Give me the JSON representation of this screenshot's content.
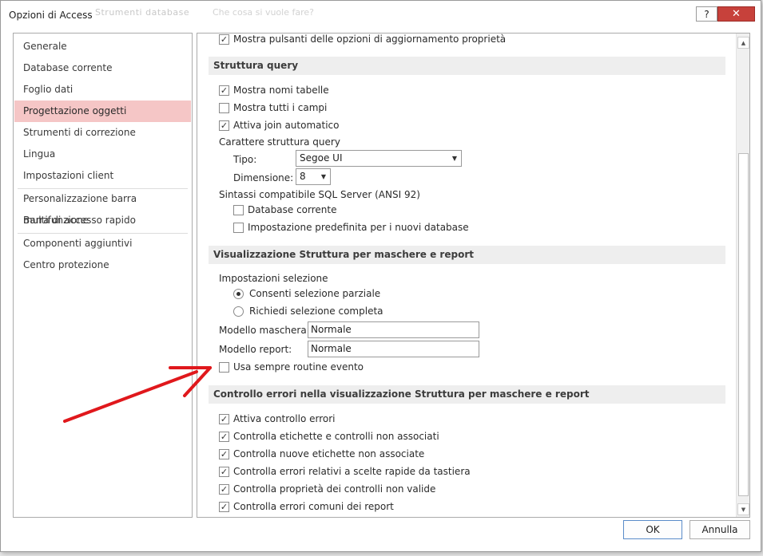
{
  "window": {
    "title": "Opzioni di Access",
    "bg_text_1": "Strumenti database",
    "bg_text_2": "Che cosa si vuole fare?",
    "help_label": "?",
    "close_label": "✕"
  },
  "nav": {
    "items": [
      {
        "label": "Generale"
      },
      {
        "label": "Database corrente"
      },
      {
        "label": "Foglio dati"
      },
      {
        "label": "Progettazione oggetti"
      },
      {
        "label": "Strumenti di correzione"
      },
      {
        "label": "Lingua"
      },
      {
        "label": "Impostazioni client"
      },
      {
        "label": "Personalizzazione barra multifunzione"
      },
      {
        "label": "Barra di accesso rapido"
      },
      {
        "label": "Componenti aggiuntivi"
      },
      {
        "label": "Centro protezione"
      }
    ],
    "active_index": 3
  },
  "content": {
    "top_option": {
      "label": "Mostra pulsanti delle opzioni di aggiornamento proprietà",
      "checked": true
    },
    "query_section": {
      "title": "Struttura query",
      "options": [
        {
          "label": "Mostra nomi tabelle",
          "checked": true
        },
        {
          "label": "Mostra tutti i campi",
          "checked": false
        },
        {
          "label": "Attiva join automatico",
          "checked": true
        }
      ],
      "font_heading": "Carattere struttura query",
      "type_label": "Tipo:",
      "type_value": "Segoe UI",
      "size_label": "Dimensione:",
      "size_value": "8",
      "sql_heading": "Sintassi compatibile SQL Server (ANSI 92)",
      "sql_options": [
        {
          "label": "Database corrente",
          "checked": false
        },
        {
          "label": "Impostazione predefinita per i nuovi database",
          "checked": false
        }
      ]
    },
    "forms_section": {
      "title": "Visualizzazione Struttura per maschere e report",
      "selection_heading": "Impostazioni selezione",
      "radio_options": [
        {
          "label": "Consenti selezione parziale",
          "selected": true
        },
        {
          "label": "Richiedi selezione completa",
          "selected": false
        }
      ],
      "form_template_label": "Modello maschera:",
      "form_template_value": "Normale",
      "report_template_label": "Modello report:",
      "report_template_value": "Normale",
      "event_option": {
        "label": "Usa sempre routine evento",
        "checked": false
      }
    },
    "errors_section": {
      "title": "Controllo errori nella visualizzazione Struttura per maschere e report",
      "options": [
        {
          "label": "Attiva controllo errori",
          "checked": true
        },
        {
          "label": "Controlla etichette e controlli non associati",
          "checked": true
        },
        {
          "label": "Controlla nuove etichette non associate",
          "checked": true
        },
        {
          "label": "Controlla errori relativi a scelte rapide da tastiera",
          "checked": true
        },
        {
          "label": "Controlla proprietà dei controlli non valide",
          "checked": true
        },
        {
          "label": "Controlla errori comuni dei report",
          "checked": true
        }
      ]
    }
  },
  "buttons": {
    "ok_label": "OK",
    "cancel_label": "Annulla"
  },
  "colors": {
    "active_nav": "#f5c6c6",
    "annotation_arrow": "#e0181c"
  },
  "icons": {
    "check": "✓",
    "dropdown": "▼",
    "scroll_up": "▲",
    "scroll_down": "▼"
  }
}
